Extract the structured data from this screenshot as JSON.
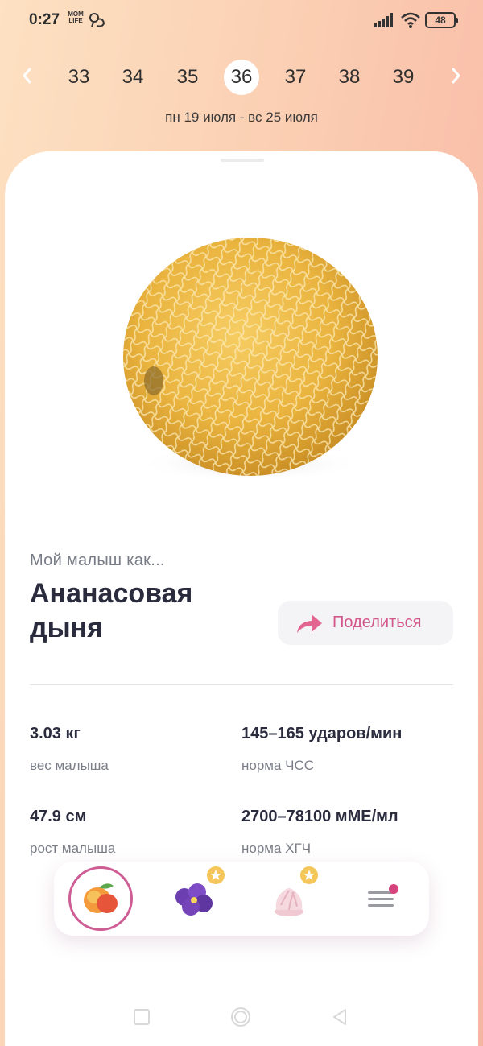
{
  "status_bar": {
    "time": "0:27",
    "app_logo_text": "MOM LIFE",
    "battery": "48",
    "icons": [
      "baby-icon",
      "signal-icon",
      "wifi-icon",
      "battery-icon"
    ]
  },
  "week_nav": {
    "weeks": [
      "33",
      "34",
      "35",
      "36",
      "37",
      "38",
      "39"
    ],
    "selected_week": "36",
    "date_range": "пн 19 июля - вс 25 июля",
    "icons": [
      "chevron-left-icon",
      "chevron-right-icon"
    ]
  },
  "fruit": {
    "image": "melon-image",
    "subtitle": "Мой малыш как...",
    "title": "Ананасовая дыня"
  },
  "share": {
    "label": "Поделиться",
    "icon": "share-arrow-icon"
  },
  "stats": [
    {
      "value": "3.03 кг",
      "label": "вес малыша"
    },
    {
      "value": "145–165 ударов/мин",
      "label": "норма ЧСС"
    },
    {
      "value": "47.9 см",
      "label": "рост малыша"
    },
    {
      "value": "2700–78100 мМЕ/мл",
      "label": "норма ХГЧ"
    }
  ],
  "bottom_nav": {
    "items": [
      {
        "icon": "peach-icon",
        "selected": true
      },
      {
        "icon": "violet-flower-icon",
        "badge": "star-icon"
      },
      {
        "icon": "marshmallow-icon",
        "badge": "star-icon"
      },
      {
        "icon": "menu-icon",
        "badge": "notification-dot"
      }
    ]
  },
  "colors": {
    "accent": "#d2578b",
    "background_gradient": [
      "#fde1c2",
      "#f8b4a3"
    ],
    "text_primary": "#2a2c3e",
    "text_secondary": "#7b7e88"
  }
}
